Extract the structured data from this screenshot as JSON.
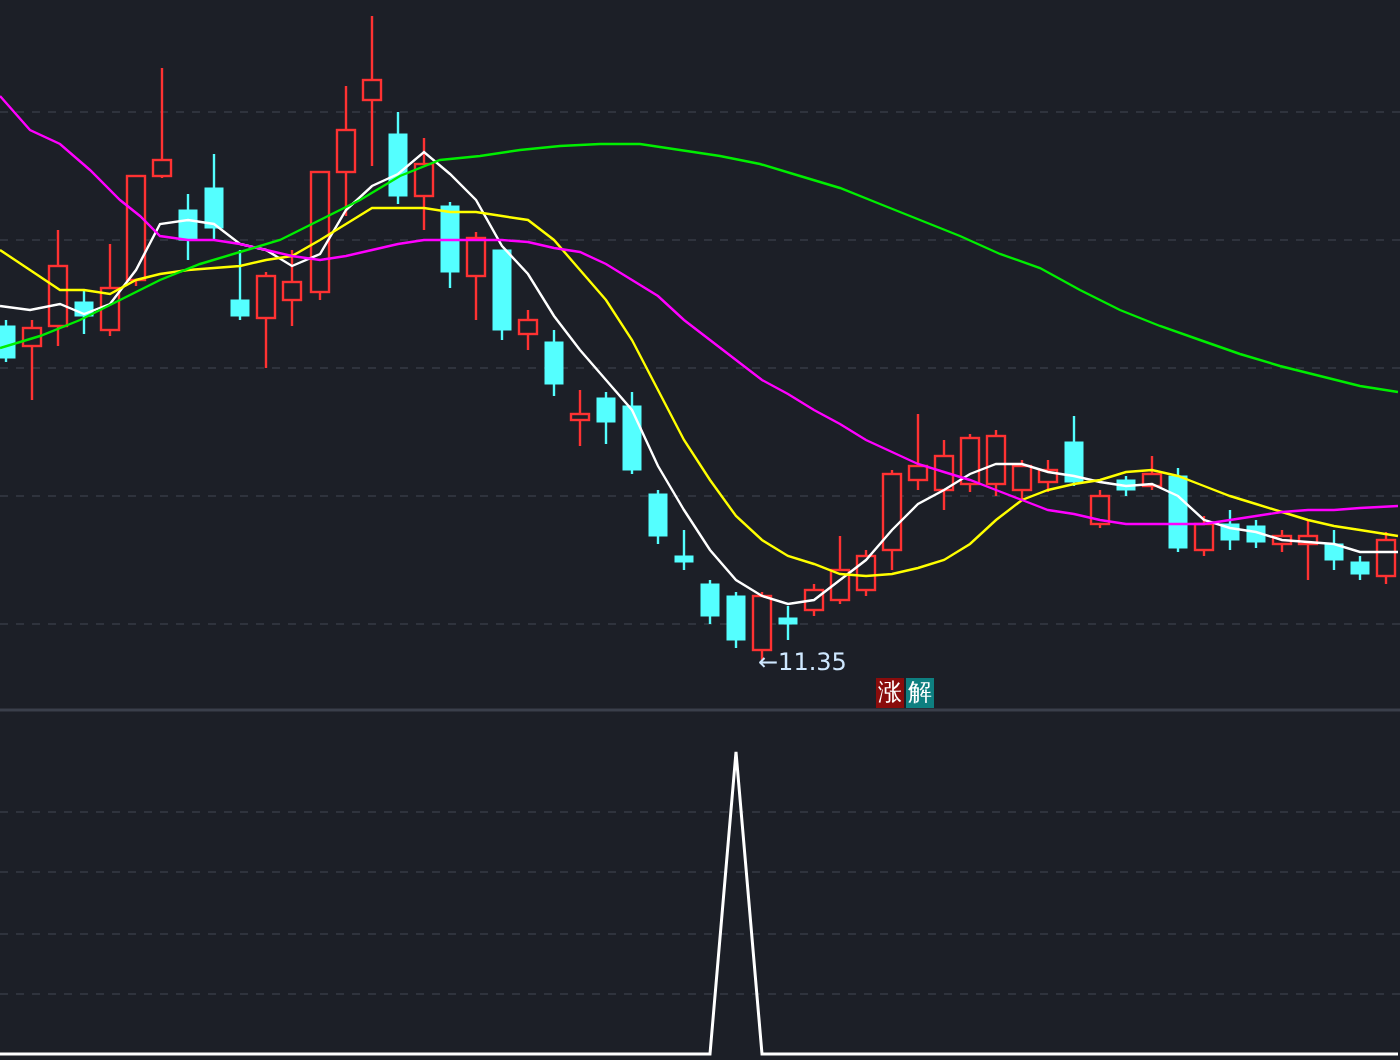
{
  "price_chart": {
    "low_marker": "←11.35",
    "signal_badges": [
      {
        "text": "涨",
        "color": "#8a0c0c"
      },
      {
        "text": "解",
        "color": "#0e7f80"
      }
    ]
  }
}
